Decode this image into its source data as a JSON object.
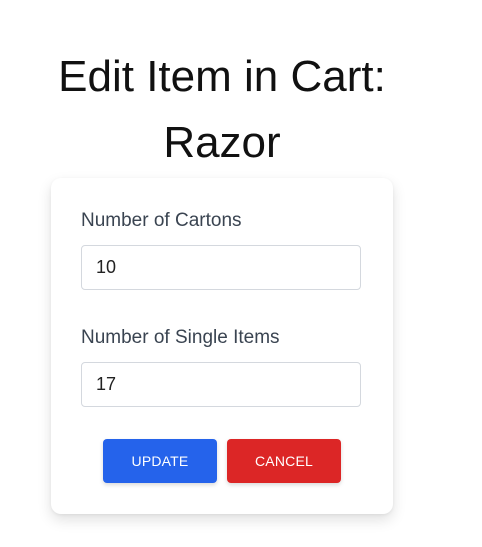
{
  "page": {
    "title_line1": "Edit Item in Cart:",
    "title_line2": "Razor"
  },
  "form": {
    "cartons": {
      "label": "Number of Cartons",
      "value": "10"
    },
    "singles": {
      "label": "Number of Single Items",
      "value": "17"
    },
    "update_label": "UPDATE",
    "cancel_label": "CANCEL"
  },
  "colors": {
    "update_button": "#2563eb",
    "cancel_button": "#dc2626",
    "label_text": "#3a4451"
  }
}
